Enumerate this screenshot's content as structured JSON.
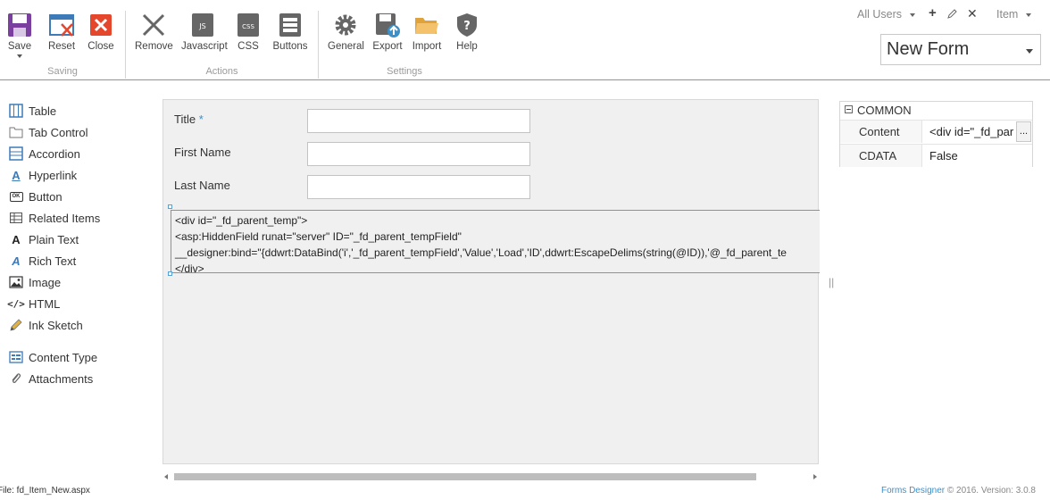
{
  "ribbon": {
    "groups": {
      "saving": "Saving",
      "actions": "Actions",
      "settings": "Settings"
    },
    "buttons": {
      "save": "Save",
      "reset": "Reset",
      "close": "Close",
      "remove": "Remove",
      "javascript": "Javascript",
      "css": "CSS",
      "buttons": "Buttons",
      "general": "General",
      "export": "Export",
      "import": "Import",
      "help": "Help"
    },
    "icon_text": {
      "js": "JS",
      "css": "CSS"
    }
  },
  "topright": {
    "audience": "All Users",
    "content_type": "Item",
    "form_name": "New Form"
  },
  "toolbox": {
    "items": [
      {
        "label": "Table",
        "icon": "table-icon"
      },
      {
        "label": "Tab Control",
        "icon": "folder-icon"
      },
      {
        "label": "Accordion",
        "icon": "accordion-icon"
      },
      {
        "label": "Hyperlink",
        "icon": "hyperlink-icon"
      },
      {
        "label": "Button",
        "icon": "button-icon"
      },
      {
        "label": "Related Items",
        "icon": "grid-icon"
      },
      {
        "label": "Plain Text",
        "icon": "plain-text-icon"
      },
      {
        "label": "Rich Text",
        "icon": "rich-text-icon"
      },
      {
        "label": "Image",
        "icon": "image-icon"
      },
      {
        "label": "HTML",
        "icon": "code-icon"
      },
      {
        "label": "Ink Sketch",
        "icon": "pencil-icon"
      },
      {
        "label": "Content Type",
        "icon": "content-type-icon"
      },
      {
        "label": "Attachments",
        "icon": "paperclip-icon"
      }
    ],
    "button_icon_text": "OK"
  },
  "form": {
    "fields": [
      {
        "label": "Title",
        "required": true,
        "required_mark": "*"
      },
      {
        "label": "First Name",
        "required": false
      },
      {
        "label": "Last Name",
        "required": false
      }
    ],
    "html_lines": [
      "<div id=\"_fd_parent_temp\">",
      "<asp:HiddenField runat=\"server\" ID=\"_fd_parent_tempField\"",
      "__designer:bind=\"{ddwrt:DataBind('i','_fd_parent_tempField','Value','Load','ID',ddwrt:EscapeDelims(string(@ID)),'@_fd_parent_te",
      "</div>"
    ]
  },
  "properties": {
    "section": "COMMON",
    "rows": [
      {
        "key": "Content",
        "value": "<div id=\"_fd_par",
        "has_button": true,
        "button_label": "..."
      },
      {
        "key": "CDATA",
        "value": "False",
        "has_button": false
      }
    ]
  },
  "splitter_glyph": "||",
  "status": {
    "file": "File: fd_Item_New.aspx",
    "product": "Forms Designer",
    "copyright": "© 2016. Version: 3.0.8"
  },
  "colors": {
    "accent": "#3d8fc6",
    "save_purple": "#7b3fa0",
    "close_red": "#e5472d",
    "ribbon_border": "#5fa3c6"
  }
}
